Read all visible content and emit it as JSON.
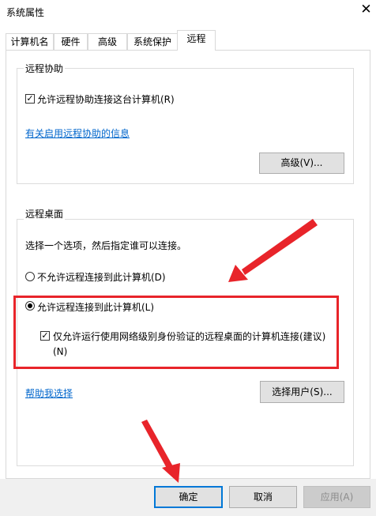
{
  "window": {
    "title": "系统属性",
    "close_glyph": "✕"
  },
  "tabs": [
    {
      "label": "计算机名"
    },
    {
      "label": "硬件"
    },
    {
      "label": "高级"
    },
    {
      "label": "系统保护"
    },
    {
      "label": "远程"
    }
  ],
  "remote_assistance": {
    "group_title": "远程协助",
    "allow_checkbox_label": "允许远程协助连接这台计算机(R)",
    "allow_checked": true,
    "info_link": "有关启用远程协助的信息",
    "advanced_button": "高级(V)..."
  },
  "remote_desktop": {
    "group_title": "远程桌面",
    "instruction": "选择一个选项，然后指定谁可以连接。",
    "option_disallow": "不允许远程连接到此计算机(D)",
    "option_allow": "允许远程连接到此计算机(L)",
    "selected": "allow",
    "nla_checkbox_line1": "仅允许运行使用网络级别身份验证的远程桌面的计算机连接(建议)",
    "nla_checkbox_line2": "(N)",
    "nla_checked": true,
    "help_link": "帮助我选择",
    "select_users_button": "选择用户(S)..."
  },
  "footer": {
    "ok": "确定",
    "cancel": "取消",
    "apply": "应用(A)"
  },
  "colors": {
    "accent": "#0078d7",
    "link": "#0066cc",
    "highlight_box": "#e8242a",
    "arrow": "#e8242a"
  }
}
